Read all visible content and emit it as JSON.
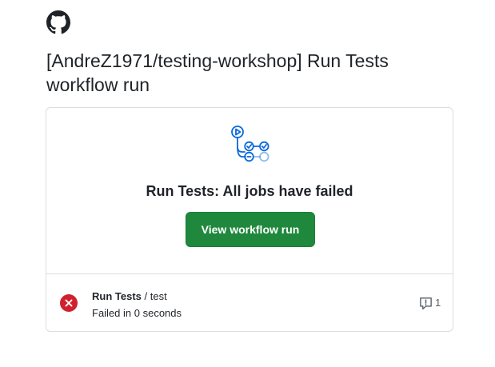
{
  "header": {
    "logo": "github-mark-icon",
    "title": "[AndreZ1971/testing-workshop] Run Tests workflow run"
  },
  "card": {
    "icon": "workflow-icon",
    "headline": "Run Tests: All jobs have failed",
    "button_label": "View workflow run",
    "button_color": "#1f883d",
    "jobs": [
      {
        "status_icon": "x-circle-fill-icon",
        "status_color": "#cf222e",
        "workflow": "Run Tests",
        "separator": " / ",
        "job": "test",
        "result": "Failed in 0 seconds",
        "annotation_icon": "comment-alert-icon",
        "annotation_count": "1"
      }
    ]
  }
}
